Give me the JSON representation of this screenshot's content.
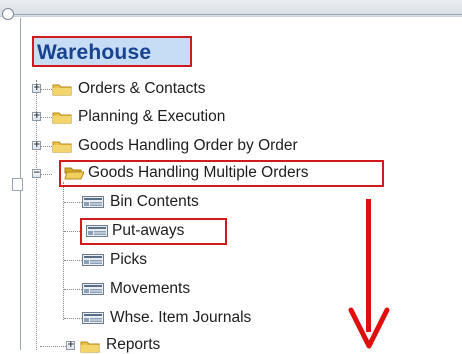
{
  "tree": {
    "root_title": "Warehouse",
    "groups": [
      {
        "label": "Orders & Contacts",
        "expanded": false
      },
      {
        "label": "Planning & Execution",
        "expanded": false
      },
      {
        "label": "Goods Handling Order by Order",
        "expanded": false
      },
      {
        "label": "Goods Handling Multiple Orders",
        "expanded": true
      },
      {
        "label": "Reports",
        "expanded": false
      }
    ],
    "children": [
      {
        "label": "Bin Contents"
      },
      {
        "label": "Put-aways"
      },
      {
        "label": "Picks"
      },
      {
        "label": "Movements"
      },
      {
        "label": "Whse. Item Journals"
      }
    ]
  },
  "expander_collapsed": "+",
  "expander_expanded": "−",
  "annotation": {
    "arrow_color": "#e10e0e",
    "highlight_color": "#d11a1a"
  }
}
